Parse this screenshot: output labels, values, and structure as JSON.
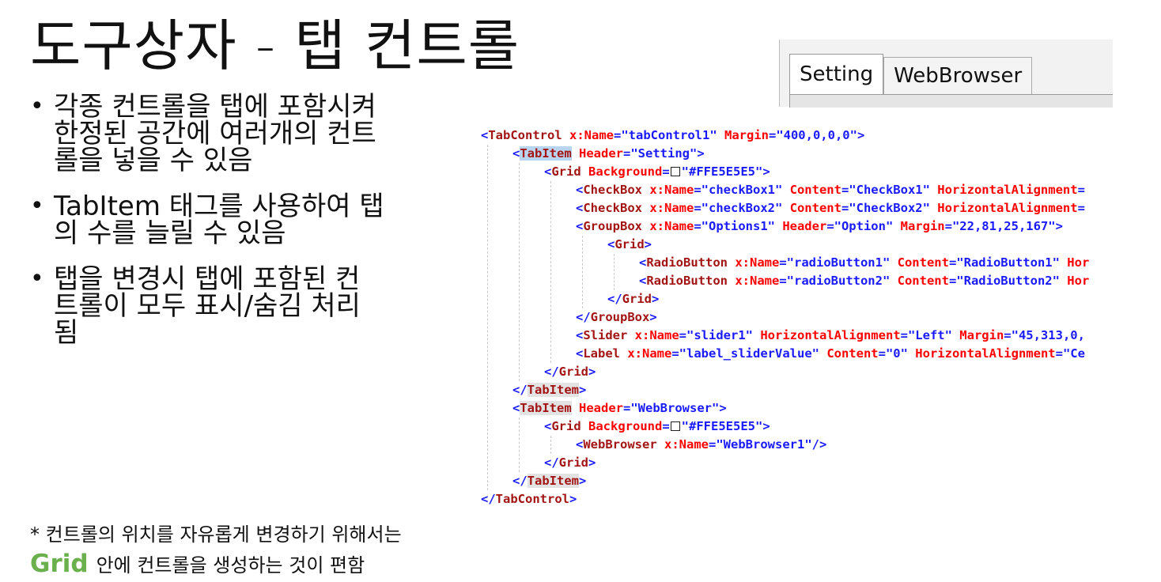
{
  "slide": {
    "title": "도구상자 - 탭 컨트롤",
    "bullets": [
      {
        "lines": [
          "각종 컨트롤을 탭에 포함시켜",
          "한정된 공간에 여러개의 컨트",
          "롤을 넣을 수 있음"
        ]
      },
      {
        "lines": [
          "TabItem 태그를 사용하여 탭",
          "의 수를 늘릴 수 있음"
        ]
      },
      {
        "lines": [
          "탭을 변경시 탭에 포함된 컨",
          "트롤이 모두 표시/숨김 처리",
          "됨"
        ]
      }
    ],
    "bullet_glyph": "•",
    "note_line1": "* 컨트롤의 위치를 자유롭게 변경하기 위해서는",
    "note_grid_word": "Grid",
    "note_line2": "안에 컨트롤을 생성하는 것이 편함",
    "note_grid_color": "#6ab04c"
  },
  "tab_preview": {
    "tabs": [
      {
        "label": "Setting",
        "active": true
      },
      {
        "label": "WebBrowser",
        "active": false
      }
    ]
  },
  "code": {
    "colors": {
      "bracket": "#1a1aff",
      "element": "#a31515",
      "attribute": "#ff0000",
      "value": "#1a1aff"
    },
    "lines": [
      {
        "indent": 0,
        "parts": [
          [
            "b",
            "<"
          ],
          [
            "el",
            "TabControl"
          ],
          [
            "at",
            " x:Name"
          ],
          [
            "b",
            "=\"tabControl1\""
          ],
          [
            "at",
            " Margin"
          ],
          [
            "b",
            "=\"400,0,0,0\">"
          ]
        ]
      },
      {
        "indent": 1,
        "parts": [
          [
            "b",
            "<"
          ],
          [
            "el",
            "TabItem",
            "hl"
          ],
          [
            "at",
            " Header"
          ],
          [
            "b",
            "=\"Setting\">"
          ]
        ]
      },
      {
        "indent": 2,
        "parts": [
          [
            "b",
            "<"
          ],
          [
            "el",
            "Grid"
          ],
          [
            "at",
            " Background"
          ],
          [
            "b",
            "="
          ],
          [
            "sw",
            ""
          ],
          [
            "b",
            "\"#FFE5E5E5\">"
          ]
        ]
      },
      {
        "indent": 3,
        "parts": [
          [
            "b",
            "<"
          ],
          [
            "el",
            "CheckBox"
          ],
          [
            "at",
            " x:Name"
          ],
          [
            "b",
            "=\"checkBox1\""
          ],
          [
            "at",
            " Content"
          ],
          [
            "b",
            "=\"CheckBox1\""
          ],
          [
            "at",
            " HorizontalAlignment"
          ],
          [
            "b",
            "="
          ]
        ]
      },
      {
        "indent": 3,
        "parts": [
          [
            "b",
            "<"
          ],
          [
            "el",
            "CheckBox"
          ],
          [
            "at",
            " x:Name"
          ],
          [
            "b",
            "=\"checkBox2\""
          ],
          [
            "at",
            " Content"
          ],
          [
            "b",
            "=\"CheckBox2\""
          ],
          [
            "at",
            " HorizontalAlignment"
          ],
          [
            "b",
            "="
          ]
        ]
      },
      {
        "indent": 3,
        "parts": [
          [
            "b",
            "<"
          ],
          [
            "el",
            "GroupBox"
          ],
          [
            "at",
            " x:Name"
          ],
          [
            "b",
            "=\"Options1\""
          ],
          [
            "at",
            " Header"
          ],
          [
            "b",
            "=\"Option\""
          ],
          [
            "at",
            " Margin"
          ],
          [
            "b",
            "=\"22,81,25,167\">"
          ]
        ]
      },
      {
        "indent": 4,
        "parts": [
          [
            "b",
            "<"
          ],
          [
            "el",
            "Grid"
          ],
          [
            "b",
            ">"
          ]
        ]
      },
      {
        "indent": 5,
        "parts": [
          [
            "b",
            "<"
          ],
          [
            "el",
            "RadioButton"
          ],
          [
            "at",
            " x:Name"
          ],
          [
            "b",
            "=\"radioButton1\""
          ],
          [
            "at",
            " Content"
          ],
          [
            "b",
            "=\"RadioButton1\""
          ],
          [
            "at",
            " Hor"
          ]
        ]
      },
      {
        "indent": 5,
        "parts": [
          [
            "b",
            "<"
          ],
          [
            "el",
            "RadioButton"
          ],
          [
            "at",
            " x:Name"
          ],
          [
            "b",
            "=\"radioButton2\""
          ],
          [
            "at",
            " Content"
          ],
          [
            "b",
            "=\"RadioButton2\""
          ],
          [
            "at",
            " Hor"
          ]
        ]
      },
      {
        "indent": 4,
        "parts": [
          [
            "b",
            "</"
          ],
          [
            "el",
            "Grid"
          ],
          [
            "b",
            ">"
          ]
        ]
      },
      {
        "indent": 3,
        "parts": [
          [
            "b",
            "</"
          ],
          [
            "el",
            "GroupBox"
          ],
          [
            "b",
            ">"
          ]
        ]
      },
      {
        "indent": 3,
        "parts": [
          [
            "b",
            "<"
          ],
          [
            "el",
            "Slider"
          ],
          [
            "at",
            " x:Name"
          ],
          [
            "b",
            "=\"slider1\""
          ],
          [
            "at",
            " HorizontalAlignment"
          ],
          [
            "b",
            "=\"Left\""
          ],
          [
            "at",
            " Margin"
          ],
          [
            "b",
            "=\"45,313,0,"
          ]
        ]
      },
      {
        "indent": 3,
        "parts": [
          [
            "b",
            "<"
          ],
          [
            "el",
            "Label"
          ],
          [
            "at",
            " x:Name"
          ],
          [
            "b",
            "=\"label_sliderValue\""
          ],
          [
            "at",
            " Content"
          ],
          [
            "b",
            "=\"0\""
          ],
          [
            "at",
            " HorizontalAlignment"
          ],
          [
            "b",
            "=\"Ce"
          ]
        ]
      },
      {
        "indent": 2,
        "parts": [
          [
            "b",
            "</"
          ],
          [
            "el",
            "Grid"
          ],
          [
            "b",
            ">"
          ]
        ]
      },
      {
        "indent": 1,
        "parts": [
          [
            "b",
            "</"
          ],
          [
            "el",
            "TabItem",
            "hl2"
          ],
          [
            "b",
            ">"
          ]
        ]
      },
      {
        "indent": 1,
        "parts": [
          [
            "b",
            "<"
          ],
          [
            "el",
            "TabItem",
            "hl2"
          ],
          [
            "at",
            " Header"
          ],
          [
            "b",
            "=\"WebBrowser\">"
          ]
        ]
      },
      {
        "indent": 2,
        "parts": [
          [
            "b",
            "<"
          ],
          [
            "el",
            "Grid"
          ],
          [
            "at",
            " Background"
          ],
          [
            "b",
            "="
          ],
          [
            "sw",
            ""
          ],
          [
            "b",
            "\"#FFE5E5E5\">"
          ]
        ]
      },
      {
        "indent": 3,
        "parts": [
          [
            "b",
            "<"
          ],
          [
            "el",
            "WebBrowser"
          ],
          [
            "at",
            " x:Name"
          ],
          [
            "b",
            "=\"WebBrowser1\"/>"
          ]
        ]
      },
      {
        "indent": 2,
        "parts": [
          [
            "b",
            "</"
          ],
          [
            "el",
            "Grid"
          ],
          [
            "b",
            ">"
          ]
        ]
      },
      {
        "indent": 1,
        "parts": [
          [
            "b",
            "</"
          ],
          [
            "el",
            "TabItem",
            "hl2"
          ],
          [
            "b",
            ">"
          ]
        ]
      },
      {
        "indent": 0,
        "parts": [
          [
            "b",
            "</"
          ],
          [
            "el",
            "TabControl"
          ],
          [
            "b",
            ">"
          ]
        ]
      }
    ]
  }
}
